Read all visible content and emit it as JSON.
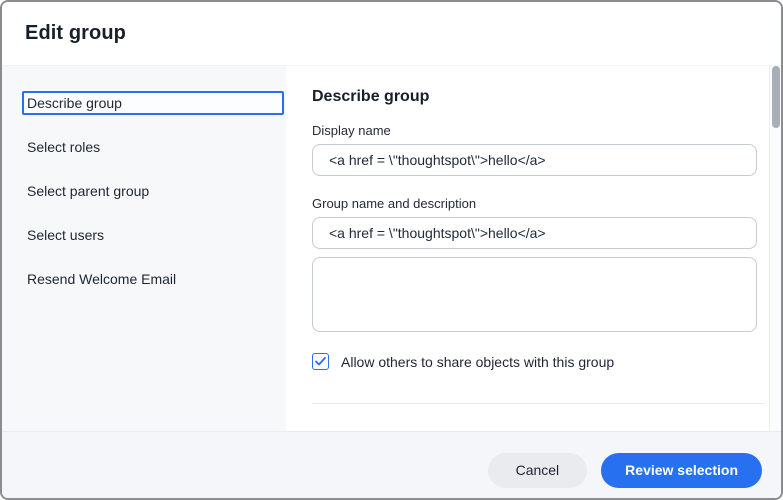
{
  "dialog": {
    "title": "Edit group"
  },
  "sidebar": {
    "items": [
      {
        "label": "Describe group",
        "selected": true
      },
      {
        "label": "Select roles",
        "selected": false
      },
      {
        "label": "Select parent group",
        "selected": false
      },
      {
        "label": "Select users",
        "selected": false
      },
      {
        "label": "Resend Welcome Email",
        "selected": false
      }
    ]
  },
  "content": {
    "heading": "Describe group",
    "fields": {
      "display_name": {
        "label": "Display name",
        "value": "<a href = \\\"thoughtspot\\\">hello</a>"
      },
      "group_name": {
        "label": "Group name and description",
        "value": "<a href = \\\"thoughtspot\\\">hello</a>"
      },
      "description": {
        "value": ""
      }
    },
    "checkbox": {
      "label": "Allow others to share objects with this group",
      "checked": true
    }
  },
  "footer": {
    "cancel_label": "Cancel",
    "review_label": "Review selection"
  },
  "colors": {
    "accent_blue": "#2770EF",
    "sidebar_bg": "#f6f8fa",
    "footer_bg": "#f5f6f9",
    "input_border": "#c5cbd3",
    "text": "#1d232f"
  }
}
